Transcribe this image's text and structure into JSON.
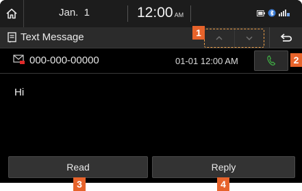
{
  "status_bar": {
    "date": "Jan.  1",
    "time": "12:00",
    "ampm": "AM",
    "icons": [
      "home-icon",
      "battery-icon",
      "bluetooth-icon",
      "signal-icon"
    ]
  },
  "title_bar": {
    "title": "Text Message",
    "icon": "message-icon",
    "prev_icon": "chevron-up-icon",
    "next_icon": "chevron-down-icon",
    "back_icon": "back-arrow-icon"
  },
  "message": {
    "sender": "000-000-00000",
    "timestamp": "01-01 12:00 AM",
    "body": "Hi",
    "status_icon": "envelope-unread-icon",
    "call_icon": "phone-icon"
  },
  "actions": {
    "read_label": "Read",
    "reply_label": "Reply"
  },
  "callouts": [
    "1",
    "2",
    "3",
    "4"
  ],
  "colors": {
    "accent": "#e7632b",
    "phone_green": "#3faa44",
    "background": "#000000"
  }
}
